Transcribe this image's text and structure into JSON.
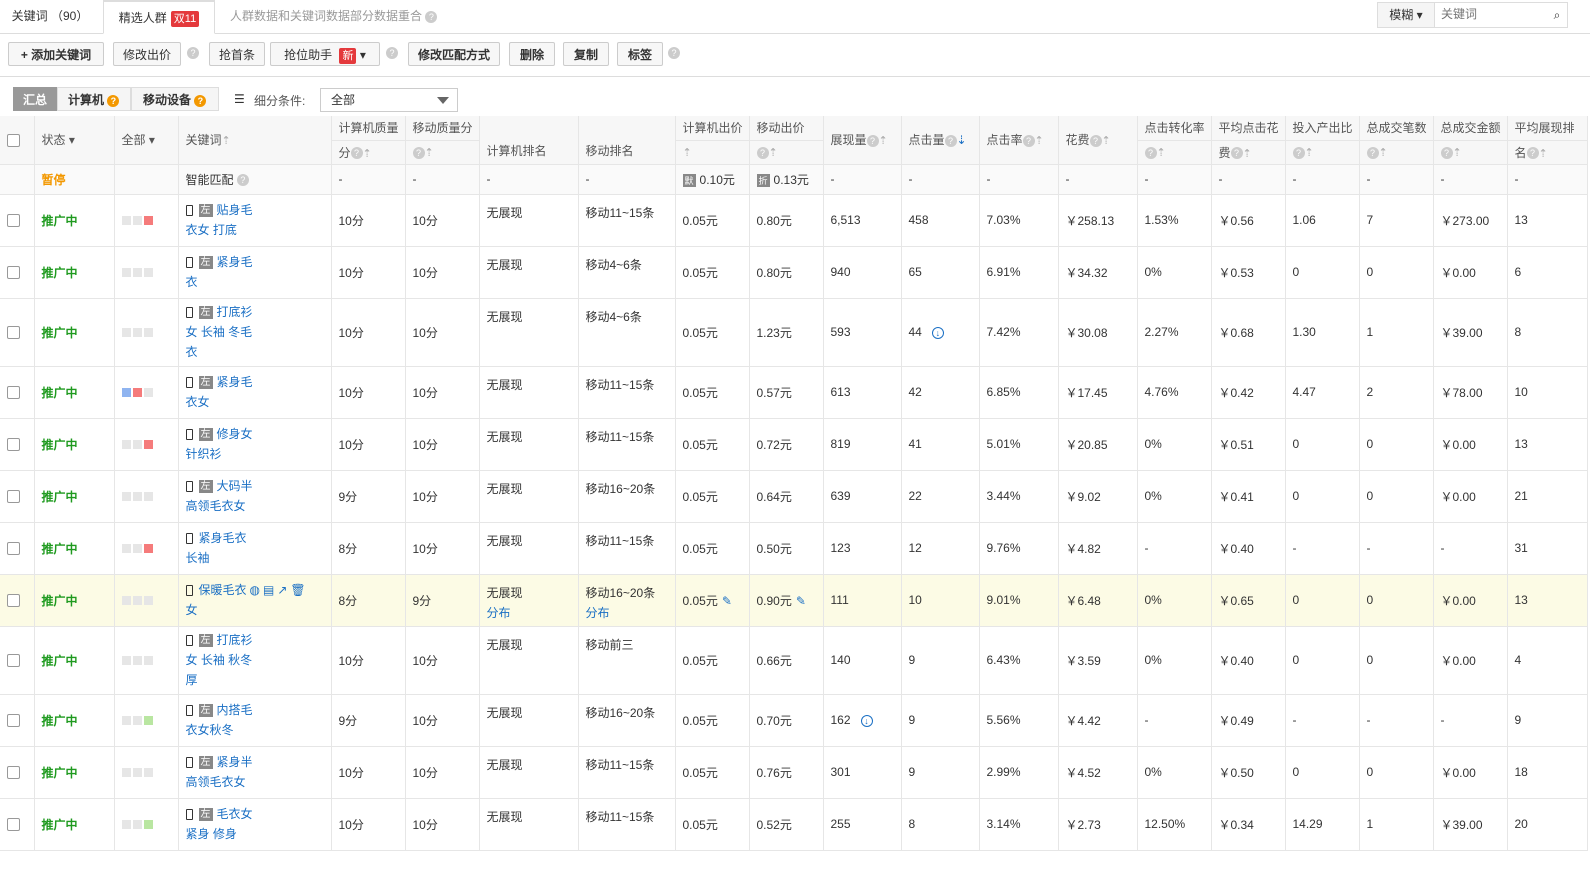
{
  "tabs": {
    "keywords": "关键词 （90）",
    "audience": "精选人群",
    "audience_badge": "双11",
    "notice": "人群数据和关键词数据部分数据重合"
  },
  "search": {
    "mode": "模糊",
    "placeholder": "关键词"
  },
  "toolbar": {
    "add": "+ 添加关键词",
    "modify_bid": "修改出价",
    "grab_first": "抢首条",
    "grab_assist": "抢位助手",
    "new_badge": "新",
    "modify_match": "修改匹配方式",
    "delete": "删除",
    "copy": "复制",
    "tag": "标签"
  },
  "filters": {
    "summary": "汇总",
    "computer": "计算机",
    "mobile": "移动设备",
    "sub_condition_label": "细分条件:",
    "sub_condition_value": "全部"
  },
  "headers": {
    "status": "状态",
    "all": "全部",
    "keyword": "关键词",
    "pc_quality": "计算机质量",
    "pc_quality_unit": "分",
    "mobile_quality": "移动质量分",
    "pc_rank": "计算机排名",
    "mobile_rank": "移动排名",
    "pc_bid": "计算机出价",
    "mobile_bid": "移动出价",
    "impressions": "展现量",
    "clicks": "点击量",
    "ctr": "点击率",
    "cost": "花费",
    "cvr": "点击转化率",
    "avg_cpc": "平均点击花",
    "avg_cpc2": "费",
    "roi": "投入产出比",
    "orders": "总成交笔数",
    "revenue": "总成交金额",
    "avg_rank": "平均展现排",
    "avg_rank2": "名"
  },
  "smart_row": {
    "status": "暂停",
    "keyword": "智能匹配",
    "dash": "-",
    "pc_tag": "默",
    "pc_bid": "0.10元",
    "mobile_tag": "折",
    "mobile_bid": "0.13元"
  },
  "rows": [
    {
      "status": "推广中",
      "sq": [
        "",
        "",
        "red",
        ""
      ],
      "kw1": "贴身毛",
      "kw2": "衣女 打底",
      "kw3": "",
      "pcq": "10分",
      "mq": "10分",
      "pcr": "无展现",
      "pcr2": "",
      "mr": "移动11~15条",
      "mr2": "",
      "pcb": "0.05元",
      "mb": "0.80元",
      "imp": "6,513",
      "clk": "458",
      "ctr": "7.03%",
      "cost": "￥258.13",
      "cvr": "1.53%",
      "cpc": "￥0.56",
      "roi": "1.06",
      "ord": "7",
      "rev": "￥273.00",
      "rank": "13"
    },
    {
      "status": "推广中",
      "sq": [
        "",
        "",
        "",
        ""
      ],
      "kw1": "紧身毛",
      "kw2": "衣",
      "kw3": "",
      "pcq": "10分",
      "mq": "10分",
      "pcr": "无展现",
      "pcr2": "",
      "mr": "移动4~6条",
      "mr2": "",
      "pcb": "0.05元",
      "mb": "0.80元",
      "imp": "940",
      "clk": "65",
      "ctr": "6.91%",
      "cost": "￥34.32",
      "cvr": "0%",
      "cpc": "￥0.53",
      "roi": "0",
      "ord": "0",
      "rev": "￥0.00",
      "rank": "6"
    },
    {
      "status": "推广中",
      "sq": [
        "",
        "",
        "",
        ""
      ],
      "kw1": "打底衫",
      "kw2": "女 长袖 冬毛",
      "kw3": "衣",
      "pcq": "10分",
      "mq": "10分",
      "pcr": "无展现",
      "pcr2": "",
      "mr": "移动4~6条",
      "mr2": "",
      "pcb": "0.05元",
      "mb": "1.23元",
      "imp": "593",
      "clk": "44",
      "ctr": "7.42%",
      "cost": "￥30.08",
      "cvr": "2.27%",
      "cpc": "￥0.68",
      "roi": "1.30",
      "ord": "1",
      "rev": "￥39.00",
      "rank": "8"
    },
    {
      "status": "推广中",
      "sq": [
        "blue",
        "red",
        "",
        ""
      ],
      "kw1": "紧身毛",
      "kw2": "衣女",
      "kw3": "",
      "pcq": "10分",
      "mq": "10分",
      "pcr": "无展现",
      "pcr2": "",
      "mr": "移动11~15条",
      "mr2": "",
      "pcb": "0.05元",
      "mb": "0.57元",
      "imp": "613",
      "clk": "42",
      "ctr": "6.85%",
      "cost": "￥17.45",
      "cvr": "4.76%",
      "cpc": "￥0.42",
      "roi": "4.47",
      "ord": "2",
      "rev": "￥78.00",
      "rank": "10"
    },
    {
      "status": "推广中",
      "sq": [
        "",
        "",
        "red",
        ""
      ],
      "kw1": "修身女",
      "kw2": "针织衫",
      "kw3": "",
      "pcq": "10分",
      "mq": "10分",
      "pcr": "无展现",
      "pcr2": "",
      "mr": "移动11~15条",
      "mr2": "",
      "pcb": "0.05元",
      "mb": "0.72元",
      "imp": "819",
      "clk": "41",
      "ctr": "5.01%",
      "cost": "￥20.85",
      "cvr": "0%",
      "cpc": "￥0.51",
      "roi": "0",
      "ord": "0",
      "rev": "￥0.00",
      "rank": "13"
    },
    {
      "status": "推广中",
      "sq": [
        "",
        "",
        "",
        ""
      ],
      "kw1": "大码半",
      "kw2": "高领毛衣女",
      "kw3": "",
      "pcq": "9分",
      "mq": "10分",
      "pcr": "无展现",
      "pcr2": "",
      "mr": "移动16~20条",
      "mr2": "",
      "pcb": "0.05元",
      "mb": "0.64元",
      "imp": "639",
      "clk": "22",
      "ctr": "3.44%",
      "cost": "￥9.02",
      "cvr": "0%",
      "cpc": "￥0.41",
      "roi": "0",
      "ord": "0",
      "rev": "￥0.00",
      "rank": "21"
    },
    {
      "status": "推广中",
      "sq": [
        "",
        "",
        "red",
        ""
      ],
      "kw1": "紧身毛衣",
      "kw2": "长袖",
      "kw3": "",
      "pcq": "8分",
      "mq": "10分",
      "pcr": "无展现",
      "pcr2": "",
      "mr": "移动11~15条",
      "mr2": "",
      "pcb": "0.05元",
      "mb": "0.50元",
      "imp": "123",
      "clk": "12",
      "ctr": "9.76%",
      "cost": "￥4.82",
      "cvr": "-",
      "cpc": "￥0.40",
      "roi": "-",
      "ord": "-",
      "rev": "-",
      "rank": "31"
    },
    {
      "status": "推广中",
      "sq": [
        "",
        "",
        "",
        ""
      ],
      "kw1": "保暖毛衣",
      "kw2": "女",
      "kw3": "",
      "pcq": "8分",
      "mq": "9分",
      "pcr": "无展现",
      "pcr2": "分布",
      "mr": "移动16~20条",
      "mr2": "分布",
      "pcb": "0.05元",
      "mb": "0.90元",
      "imp": "111",
      "clk": "10",
      "ctr": "9.01%",
      "cost": "￥6.48",
      "cvr": "0%",
      "cpc": "￥0.65",
      "roi": "0",
      "ord": "0",
      "rev": "￥0.00",
      "rank": "13"
    },
    {
      "status": "推广中",
      "sq": [
        "",
        "",
        "",
        ""
      ],
      "kw1": "打底衫",
      "kw2": "女 长袖 秋冬",
      "kw3": "厚",
      "pcq": "10分",
      "mq": "10分",
      "pcr": "无展现",
      "pcr2": "",
      "mr": "移动前三",
      "mr2": "",
      "pcb": "0.05元",
      "mb": "0.66元",
      "imp": "140",
      "clk": "9",
      "ctr": "6.43%",
      "cost": "￥3.59",
      "cvr": "0%",
      "cpc": "￥0.40",
      "roi": "0",
      "ord": "0",
      "rev": "￥0.00",
      "rank": "4"
    },
    {
      "status": "推广中",
      "sq": [
        "",
        "",
        "lg",
        ""
      ],
      "kw1": "内搭毛",
      "kw2": "衣女秋冬",
      "kw3": "",
      "pcq": "9分",
      "mq": "10分",
      "pcr": "无展现",
      "pcr2": "",
      "mr": "移动16~20条",
      "mr2": "",
      "pcb": "0.05元",
      "mb": "0.70元",
      "imp": "162",
      "clk": "9",
      "ctr": "5.56%",
      "cost": "￥4.42",
      "cvr": "-",
      "cpc": "￥0.49",
      "roi": "-",
      "ord": "-",
      "rev": "-",
      "rank": "9"
    },
    {
      "status": "推广中",
      "sq": [
        "",
        "",
        "",
        ""
      ],
      "kw1": "紧身半",
      "kw2": "高领毛衣女",
      "kw3": "",
      "pcq": "10分",
      "mq": "10分",
      "pcr": "无展现",
      "pcr2": "",
      "mr": "移动11~15条",
      "mr2": "",
      "pcb": "0.05元",
      "mb": "0.76元",
      "imp": "301",
      "clk": "9",
      "ctr": "2.99%",
      "cost": "￥4.52",
      "cvr": "0%",
      "cpc": "￥0.50",
      "roi": "0",
      "ord": "0",
      "rev": "￥0.00",
      "rank": "18"
    },
    {
      "status": "推广中",
      "sq": [
        "",
        "",
        "lg",
        ""
      ],
      "kw1": "毛衣女",
      "kw2": "紧身 修身",
      "kw3": "",
      "pcq": "10分",
      "mq": "10分",
      "pcr": "无展现",
      "pcr2": "",
      "mr": "移动11~15条",
      "mr2": "",
      "pcb": "0.05元",
      "mb": "0.52元",
      "imp": "255",
      "clk": "8",
      "ctr": "3.14%",
      "cost": "￥2.73",
      "cvr": "12.50%",
      "cpc": "￥0.34",
      "roi": "14.29",
      "ord": "1",
      "rev": "￥39.00",
      "rank": "20"
    }
  ],
  "colors": {
    "link": "#1a6fc4",
    "status_green": "#1f9a1f",
    "paused_orange": "#f39800",
    "highlight_row": "#fcfbe5",
    "badge_red": "#e4393c"
  }
}
